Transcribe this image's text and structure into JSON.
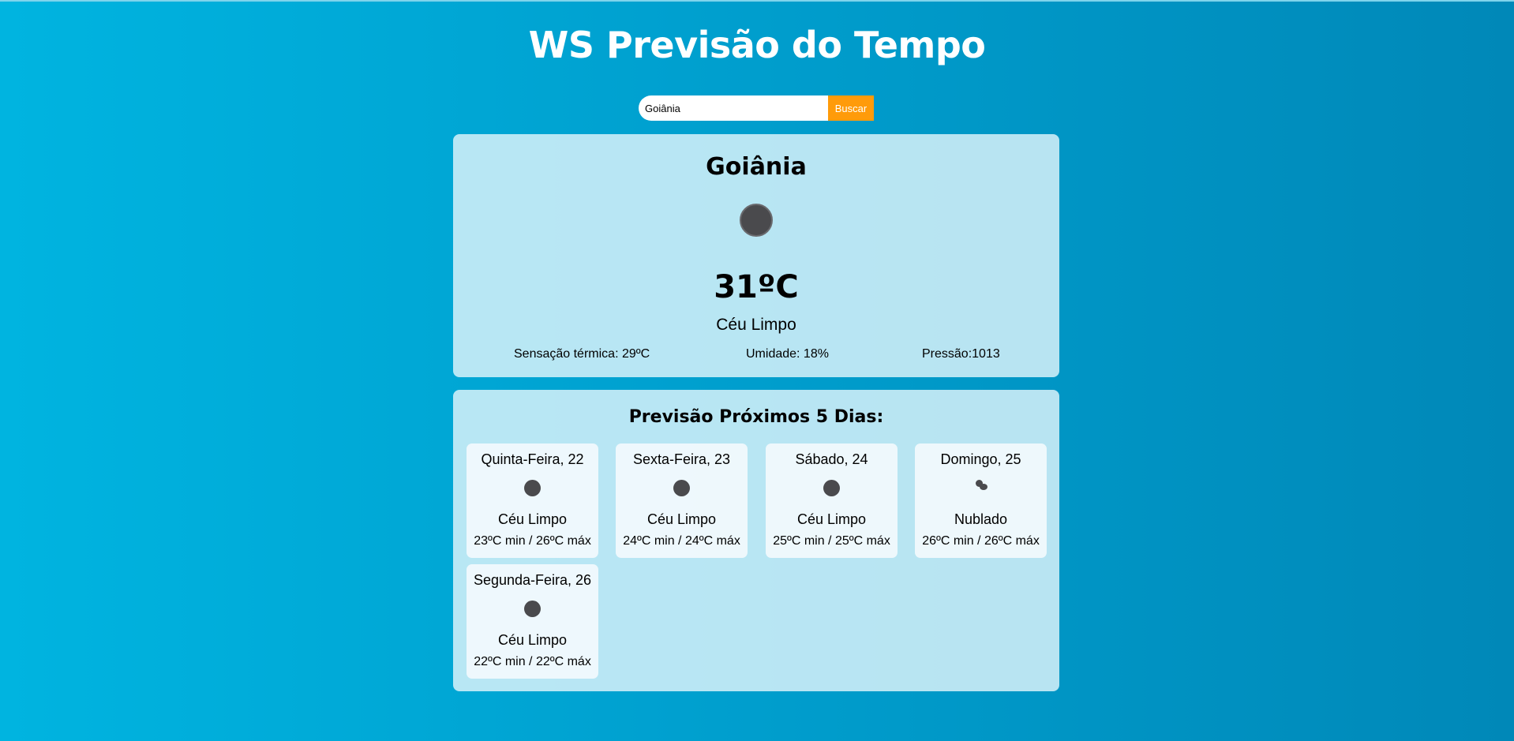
{
  "header": {
    "title": "WS Previsão do Tempo"
  },
  "search": {
    "value": "Goiânia",
    "button_label": "Buscar"
  },
  "current": {
    "city": "Goiânia",
    "icon": "clear-sky-icon",
    "temperature": "31ºC",
    "condition": "Céu Limpo",
    "feels_like": "Sensação térmica: 29ºC",
    "humidity": "Umidade: 18%",
    "pressure": "Pressão:1013"
  },
  "forecast": {
    "title": "Previsão Próximos 5 Dias:",
    "days": [
      {
        "day": "Quinta-Feira, 22",
        "icon": "clear-sky-icon",
        "condition": "Céu Limpo",
        "range": "23ºC min / 26ºC máx"
      },
      {
        "day": "Sexta-Feira, 23",
        "icon": "clear-sky-icon",
        "condition": "Céu Limpo",
        "range": "24ºC min / 24ºC máx"
      },
      {
        "day": "Sábado, 24",
        "icon": "clear-sky-icon",
        "condition": "Céu Limpo",
        "range": "25ºC min / 25ºC máx"
      },
      {
        "day": "Domingo, 25",
        "icon": "cloudy-icon",
        "condition": "Nublado",
        "range": "26ºC min / 26ºC máx"
      },
      {
        "day": "Segunda-Feira, 26",
        "icon": "clear-sky-icon",
        "condition": "Céu Limpo",
        "range": "22ºC min / 22ºC máx"
      }
    ]
  },
  "colors": {
    "button": "#ff9b0a",
    "title_text": "#ffffff",
    "background_start": "#00b4e0",
    "background_end": "#0088b8"
  }
}
